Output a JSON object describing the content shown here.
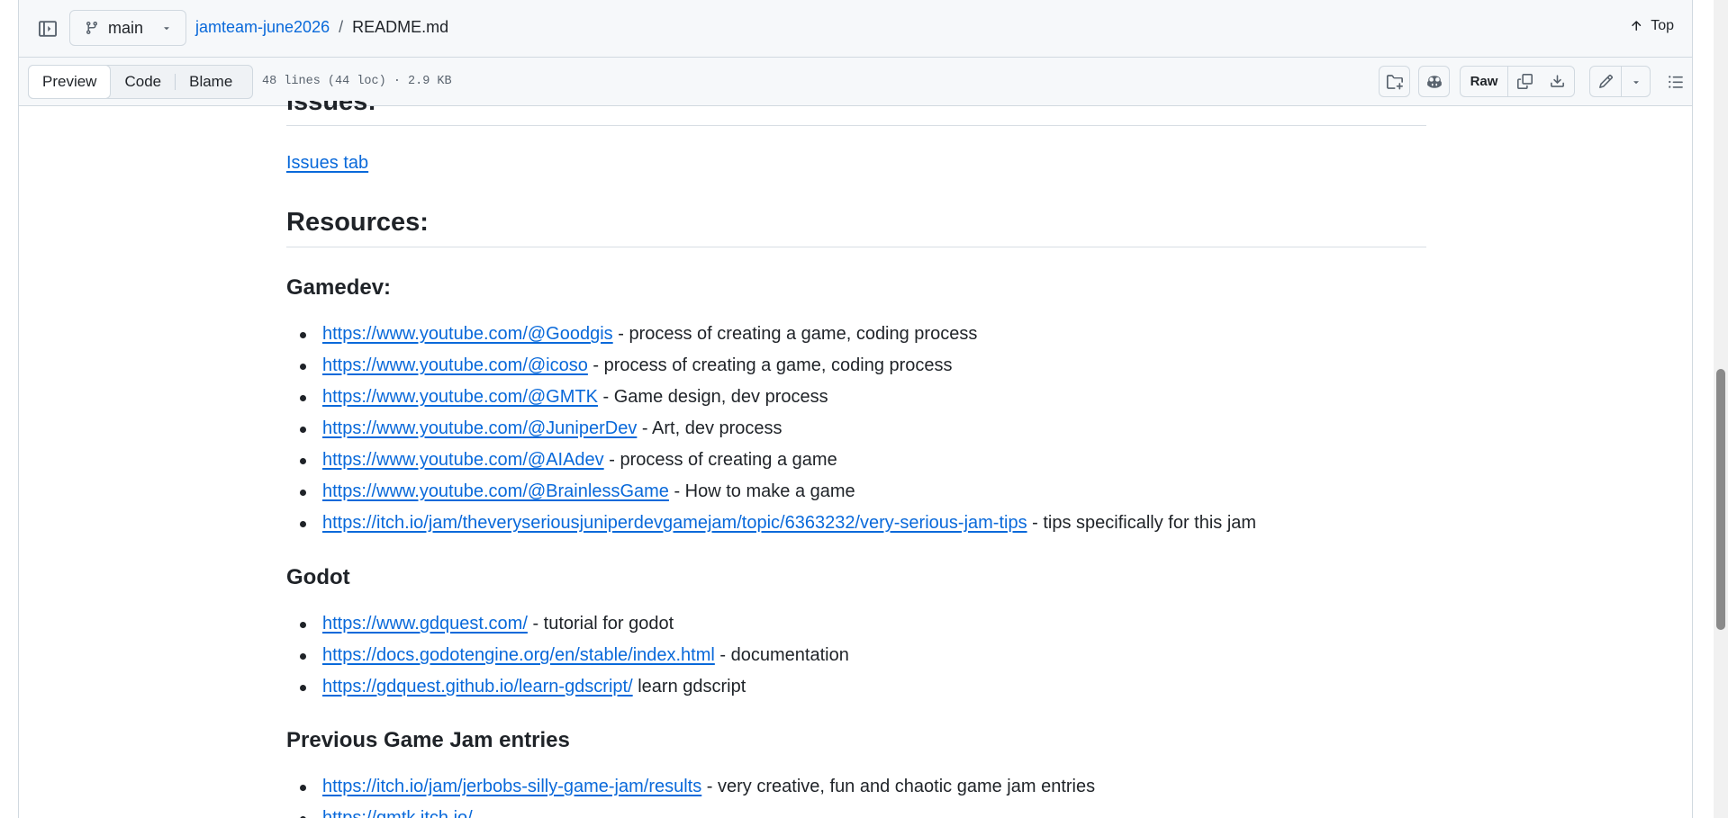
{
  "header": {
    "branch": "main",
    "repo": "jamteam-june2026",
    "separator": "/",
    "file": "README.md",
    "top_label": "Top"
  },
  "toolbar": {
    "tabs": [
      "Preview",
      "Code",
      "Blame"
    ],
    "active_tab": "Preview",
    "file_meta": "48 lines (44 loc) · 2.9 KB",
    "raw_label": "Raw"
  },
  "content": {
    "issues_heading": "Issues:",
    "issues_link": "Issues tab",
    "resources_heading": "Resources:",
    "gamedev_heading": "Gamedev:",
    "gamedev_items": [
      {
        "url": "https://www.youtube.com/@Goodgis",
        "desc": " - process of creating a game, coding process"
      },
      {
        "url": "https://www.youtube.com/@icoso",
        "desc": " - process of creating a game, coding process"
      },
      {
        "url": "https://www.youtube.com/@GMTK",
        "desc": " - Game design, dev process"
      },
      {
        "url": "https://www.youtube.com/@JuniperDev",
        "desc": " - Art, dev process"
      },
      {
        "url": "https://www.youtube.com/@AIAdev",
        "desc": " - process of creating a game"
      },
      {
        "url": "https://www.youtube.com/@BrainlessGame",
        "desc": " - How to make a game"
      },
      {
        "url": "https://itch.io/jam/theveryseriousjuniperdevgamejam/topic/6363232/very-serious-jam-tips",
        "desc": " - tips specifically for this jam"
      }
    ],
    "godot_heading": "Godot",
    "godot_items": [
      {
        "url": "https://www.gdquest.com/",
        "desc": " - tutorial for godot"
      },
      {
        "url": "https://docs.godotengine.org/en/stable/index.html",
        "desc": " - documentation"
      },
      {
        "url": "https://gdquest.github.io/learn-gdscript/",
        "desc": " learn gdscript"
      }
    ],
    "prev_heading": "Previous Game Jam entries",
    "prev_items": [
      {
        "url": "https://itch.io/jam/jerbobs-silly-game-jam/results",
        "desc": " - very creative, fun and chaotic game jam entries"
      },
      {
        "url": "https://gmtk.itch.io/",
        "desc": ""
      }
    ]
  },
  "colors": {
    "link": "#0969da",
    "text": "#1f2328",
    "muted": "#59636e",
    "header_bg": "#f6f8fa",
    "border": "#d1d9e0"
  },
  "icons": [
    "sidebar-toggle-icon",
    "git-branch-icon",
    "caret-down-icon",
    "arrow-up-icon",
    "file-directory-add-icon",
    "copilot-icon",
    "copy-icon",
    "download-icon",
    "pencil-icon",
    "list-unordered-icon"
  ]
}
